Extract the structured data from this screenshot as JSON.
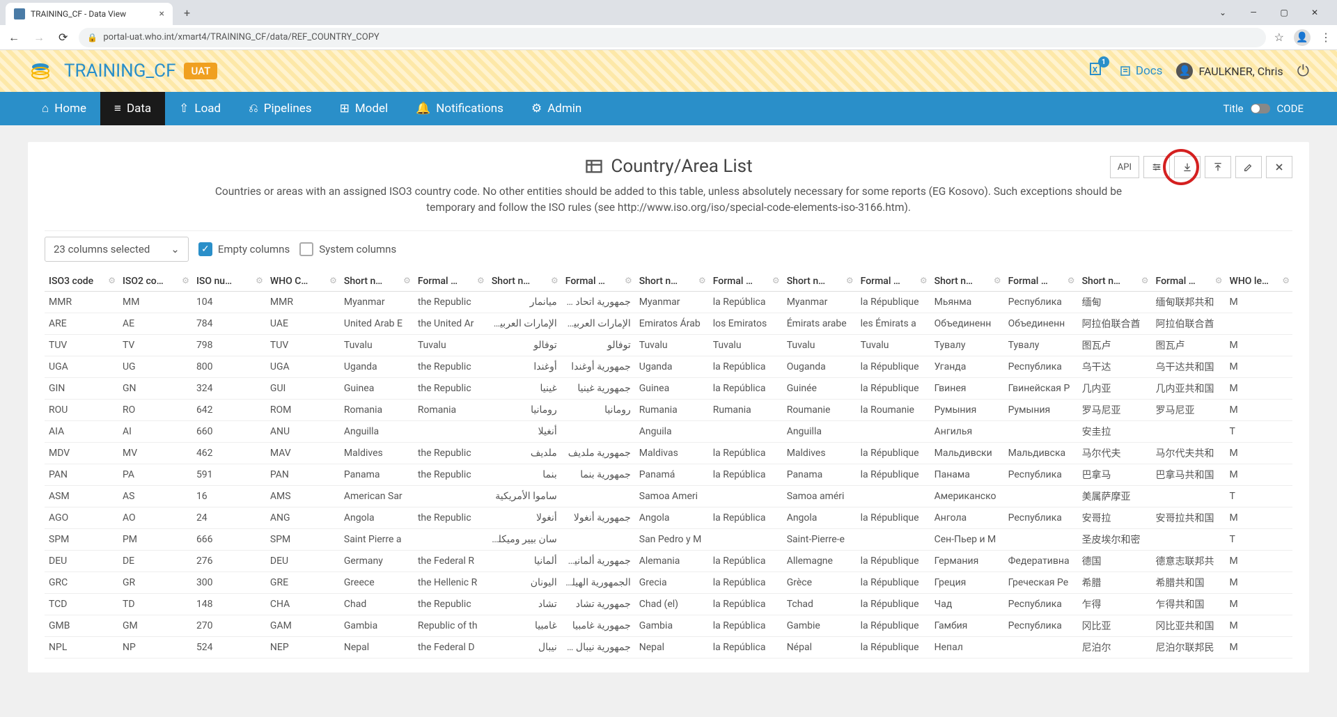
{
  "browser": {
    "tab_title": "TRAINING_CF - Data View",
    "url": "portal-uat.who.int/xmart4/TRAINING_CF/data/REF_COUNTRY_COPY"
  },
  "header": {
    "app_title": "TRAINING_CF",
    "env_badge": "UAT",
    "excel_count": "1",
    "docs_label": "Docs",
    "user_name": "FAULKNER, Chris"
  },
  "nav": {
    "items": [
      {
        "label": "Home",
        "icon": "home"
      },
      {
        "label": "Data",
        "icon": "data",
        "active": true
      },
      {
        "label": "Load",
        "icon": "upload"
      },
      {
        "label": "Pipelines",
        "icon": "pipeline"
      },
      {
        "label": "Model",
        "icon": "model"
      },
      {
        "label": "Notifications",
        "icon": "bell"
      },
      {
        "label": "Admin",
        "icon": "gear"
      }
    ],
    "title_label": "Title",
    "code_label": "CODE"
  },
  "panel": {
    "title": "Country/Area List",
    "description": "Countries or areas with an assigned ISO3 country code. No other entities should be added to this table, unless absolutely necessary for some reports (EG Kosovo). Such exceptions should be temporary and follow the ISO rules (see http://www.iso.org/iso/special-code-elements-iso-3166.htm).",
    "api_button": "API"
  },
  "filters": {
    "columns_selected": "23 columns selected",
    "empty_columns": "Empty columns",
    "system_columns": "System columns"
  },
  "table": {
    "headers": [
      "ISO3 code",
      "ISO2 co…",
      "ISO nu…",
      "WHO C…",
      "Short n…",
      "Formal …",
      "Short n…",
      "Formal …",
      "Short n…",
      "Formal …",
      "Short n…",
      "Formal …",
      "Short n…",
      "Formal …",
      "Short n…",
      "Formal …",
      "WHO le…"
    ],
    "rows": [
      {
        "iso3": "MMR",
        "iso2": "MM",
        "isonum": "104",
        "whoc": "MMR",
        "short_en": "Myanmar",
        "formal_en": "the Republic",
        "short_ar": "ميانمار",
        "formal_ar": "جمهورية اتحاد ميانمار",
        "short_es": "Myanmar",
        "formal_es": "la República",
        "short_fr": "Myanmar",
        "formal_fr": "la République",
        "short_ru": "Мьянма",
        "formal_ru": "Республика",
        "short_zh": "缅甸",
        "formal_zh": "缅甸联邦共和",
        "wholegal": "M"
      },
      {
        "iso3": "ARE",
        "iso2": "AE",
        "isonum": "784",
        "whoc": "UAE",
        "short_en": "United Arab E",
        "formal_en": "the United Ar",
        "short_ar": "الإمارات العربية المتحدة",
        "formal_ar": "الإمارات العربية المتحدة",
        "short_es": "Emiratos Árab",
        "formal_es": "los Emiratos",
        "short_fr": "Émirats arabe",
        "formal_fr": "les Émirats a",
        "short_ru": "Объединенн",
        "formal_ru": "Объединенн",
        "short_zh": "阿拉伯联合酋",
        "formal_zh": "阿拉伯联合酋",
        "wholegal": ""
      },
      {
        "iso3": "TUV",
        "iso2": "TV",
        "isonum": "798",
        "whoc": "TUV",
        "short_en": "Tuvalu",
        "formal_en": "Tuvalu",
        "short_ar": "توفالو",
        "formal_ar": "توفالو",
        "short_es": "Tuvalu",
        "formal_es": "Tuvalu",
        "short_fr": "Tuvalu",
        "formal_fr": "Tuvalu",
        "short_ru": "Тувалу",
        "formal_ru": "Тувалу",
        "short_zh": "图瓦卢",
        "formal_zh": "图瓦卢",
        "wholegal": "M"
      },
      {
        "iso3": "UGA",
        "iso2": "UG",
        "isonum": "800",
        "whoc": "UGA",
        "short_en": "Uganda",
        "formal_en": "the Republic",
        "short_ar": "أوغندا",
        "formal_ar": "جمهورية أوغندا",
        "short_es": "Uganda",
        "formal_es": "la República",
        "short_fr": "Ouganda",
        "formal_fr": "la République",
        "short_ru": "Уганда",
        "formal_ru": "Республика",
        "short_zh": "乌干达",
        "formal_zh": "乌干达共和国",
        "wholegal": "M"
      },
      {
        "iso3": "GIN",
        "iso2": "GN",
        "isonum": "324",
        "whoc": "GUI",
        "short_en": "Guinea",
        "formal_en": "the Republic",
        "short_ar": "غينيا",
        "formal_ar": "جمهورية غينيا",
        "short_es": "Guinea",
        "formal_es": "la República",
        "short_fr": "Guinée",
        "formal_fr": "la République",
        "short_ru": "Гвинея",
        "formal_ru": "Гвинейская Р",
        "short_zh": "几内亚",
        "formal_zh": "几内亚共和国",
        "wholegal": "M"
      },
      {
        "iso3": "ROU",
        "iso2": "RO",
        "isonum": "642",
        "whoc": "ROM",
        "short_en": "Romania",
        "formal_en": "Romania",
        "short_ar": "رومانيا",
        "formal_ar": "رومانيا",
        "short_es": "Rumania",
        "formal_es": "Rumania",
        "short_fr": "Roumanie",
        "formal_fr": "la Roumanie",
        "short_ru": "Румыния",
        "formal_ru": "Румыния",
        "short_zh": "罗马尼亚",
        "formal_zh": "罗马尼亚",
        "wholegal": "M"
      },
      {
        "iso3": "AIA",
        "iso2": "AI",
        "isonum": "660",
        "whoc": "ANU",
        "short_en": "Anguilla",
        "formal_en": "",
        "short_ar": "أنغيلا",
        "formal_ar": "",
        "short_es": "Anguila",
        "formal_es": "",
        "short_fr": "Anguilla",
        "formal_fr": "",
        "short_ru": "Ангилья",
        "formal_ru": "",
        "short_zh": "安圭拉",
        "formal_zh": "",
        "wholegal": "T"
      },
      {
        "iso3": "MDV",
        "iso2": "MV",
        "isonum": "462",
        "whoc": "MAV",
        "short_en": "Maldives",
        "formal_en": "the Republic",
        "short_ar": "ملديف",
        "formal_ar": "جمهورية ملديف",
        "short_es": "Maldivas",
        "formal_es": "la República",
        "short_fr": "Maldives",
        "formal_fr": "la République",
        "short_ru": "Мальдивски",
        "formal_ru": "Мальдивска",
        "short_zh": "马尔代夫",
        "formal_zh": "马尔代夫共和",
        "wholegal": "M"
      },
      {
        "iso3": "PAN",
        "iso2": "PA",
        "isonum": "591",
        "whoc": "PAN",
        "short_en": "Panama",
        "formal_en": "the Republic",
        "short_ar": "بنما",
        "formal_ar": "جمهورية بنما",
        "short_es": "Panamá",
        "formal_es": "la República",
        "short_fr": "Panama",
        "formal_fr": "la République",
        "short_ru": "Панама",
        "formal_ru": "Республика",
        "short_zh": "巴拿马",
        "formal_zh": "巴拿马共和国",
        "wholegal": "M"
      },
      {
        "iso3": "ASM",
        "iso2": "AS",
        "isonum": "16",
        "whoc": "AMS",
        "short_en": "American Sar",
        "formal_en": "",
        "short_ar": "ساموا الأمريكية",
        "formal_ar": "",
        "short_es": "Samoa Ameri",
        "formal_es": "",
        "short_fr": "Samoa améri",
        "formal_fr": "",
        "short_ru": "Американско",
        "formal_ru": "",
        "short_zh": "美属萨摩亚",
        "formal_zh": "",
        "wholegal": "T"
      },
      {
        "iso3": "AGO",
        "iso2": "AO",
        "isonum": "24",
        "whoc": "ANG",
        "short_en": "Angola",
        "formal_en": "the Republic",
        "short_ar": "أنغولا",
        "formal_ar": "جمهورية أنغولا",
        "short_es": "Angola",
        "formal_es": "la República",
        "short_fr": "Angola",
        "formal_fr": "la République",
        "short_ru": "Ангола",
        "formal_ru": "Республика",
        "short_zh": "安哥拉",
        "formal_zh": "安哥拉共和国",
        "wholegal": "M"
      },
      {
        "iso3": "SPM",
        "iso2": "PM",
        "isonum": "666",
        "whoc": "SPM",
        "short_en": "Saint Pierre a",
        "formal_en": "",
        "short_ar": "سان بيير وميكلون",
        "formal_ar": "",
        "short_es": "San Pedro y M",
        "formal_es": "",
        "short_fr": "Saint-Pierre-e",
        "formal_fr": "",
        "short_ru": "Сен-Пьер и М",
        "formal_ru": "",
        "short_zh": "圣皮埃尔和密",
        "formal_zh": "",
        "wholegal": "T"
      },
      {
        "iso3": "DEU",
        "iso2": "DE",
        "isonum": "276",
        "whoc": "DEU",
        "short_en": "Germany",
        "formal_en": "the Federal R",
        "short_ar": "ألمانيا",
        "formal_ar": "جمهورية ألمانيا الاتحادية",
        "short_es": "Alemania",
        "formal_es": "la República",
        "short_fr": "Allemagne",
        "formal_fr": "la République",
        "short_ru": "Германия",
        "formal_ru": "Федеративна",
        "short_zh": "德国",
        "formal_zh": "德意志联邦共",
        "wholegal": "M"
      },
      {
        "iso3": "GRC",
        "iso2": "GR",
        "isonum": "300",
        "whoc": "GRE",
        "short_en": "Greece",
        "formal_en": "the Hellenic R",
        "short_ar": "اليونان",
        "formal_ar": "الجمهورية الهيلينية",
        "short_es": "Grecia",
        "formal_es": "la República",
        "short_fr": "Grèce",
        "formal_fr": "la République",
        "short_ru": "Греция",
        "formal_ru": "Греческая Ре",
        "short_zh": "希腊",
        "formal_zh": "希腊共和国",
        "wholegal": "M"
      },
      {
        "iso3": "TCD",
        "iso2": "TD",
        "isonum": "148",
        "whoc": "CHA",
        "short_en": "Chad",
        "formal_en": "the Republic",
        "short_ar": "تشاد",
        "formal_ar": "جمهورية تشاد",
        "short_es": "Chad (el)",
        "formal_es": "la República",
        "short_fr": "Tchad",
        "formal_fr": "la République",
        "short_ru": "Чад",
        "formal_ru": "Республика",
        "short_zh": "乍得",
        "formal_zh": "乍得共和国",
        "wholegal": "M"
      },
      {
        "iso3": "GMB",
        "iso2": "GM",
        "isonum": "270",
        "whoc": "GAM",
        "short_en": "Gambia",
        "formal_en": "Republic of th",
        "short_ar": "غامبيا",
        "formal_ar": "جمهورية غامبيا",
        "short_es": "Gambia",
        "formal_es": "la República",
        "short_fr": "Gambie",
        "formal_fr": "la République",
        "short_ru": "Гамбия",
        "formal_ru": "Республика",
        "short_zh": "冈比亚",
        "formal_zh": "冈比亚共和国",
        "wholegal": "M"
      },
      {
        "iso3": "NPL",
        "iso2": "NP",
        "isonum": "524",
        "whoc": "NEP",
        "short_en": "Nepal",
        "formal_en": "the Federal D",
        "short_ar": "نيبال",
        "formal_ar": "جمهورية نيبال الديمقراطية الاتحادية",
        "short_es": "Nepal",
        "formal_es": "la República",
        "short_fr": "Népal",
        "formal_fr": "la République",
        "short_ru": "Непал",
        "formal_ru": "",
        "short_zh": "尼泊尔",
        "formal_zh": "尼泊尔联邦民",
        "wholegal": "M"
      }
    ]
  }
}
